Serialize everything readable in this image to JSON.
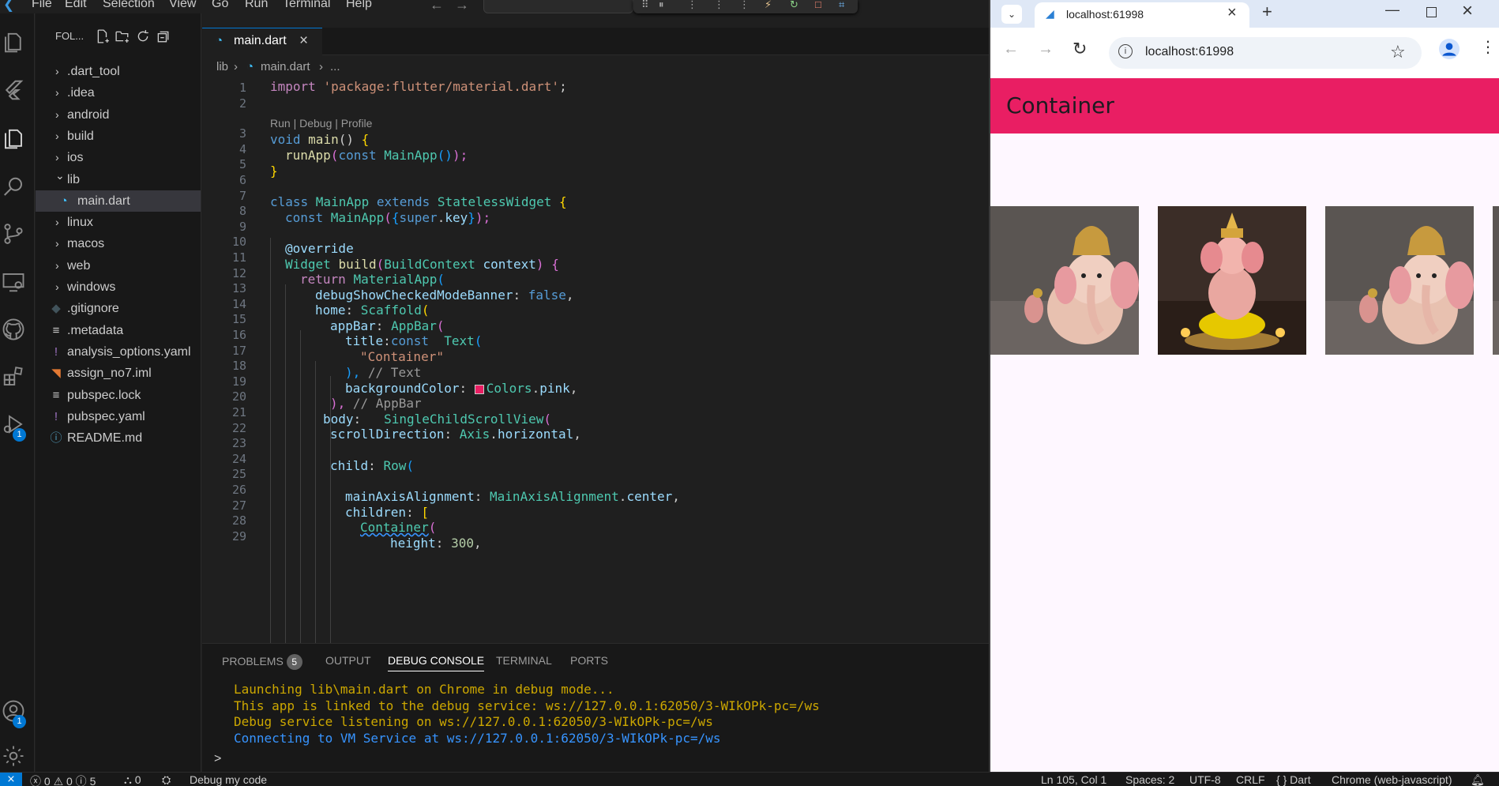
{
  "menubar": {
    "items": [
      "File",
      "Edit",
      "Selection",
      "View",
      "Go",
      "Run",
      "Terminal",
      "Help"
    ]
  },
  "activity_bar": {
    "items": [
      {
        "name": "explorer",
        "icon": "files-icon"
      },
      {
        "name": "flutter",
        "icon": "flutter-icon"
      },
      {
        "name": "explorer-active",
        "icon": "files-icon"
      },
      {
        "name": "search",
        "icon": "search-icon"
      },
      {
        "name": "source-control",
        "icon": "source-control-icon"
      },
      {
        "name": "remote-explorer",
        "icon": "remote-explorer-icon"
      },
      {
        "name": "github",
        "icon": "github-icon"
      },
      {
        "name": "extensions",
        "icon": "extensions-icon"
      },
      {
        "name": "run-debug",
        "icon": "run-debug-icon",
        "badge": "1"
      }
    ],
    "accounts_badge": "1"
  },
  "explorer": {
    "title": "FOL...",
    "items": [
      {
        "label": ".dart_tool",
        "type": "folder",
        "expanded": false
      },
      {
        "label": ".idea",
        "type": "folder",
        "expanded": false
      },
      {
        "label": "android",
        "type": "folder",
        "expanded": false
      },
      {
        "label": "build",
        "type": "folder",
        "expanded": false
      },
      {
        "label": "ios",
        "type": "folder",
        "expanded": false
      },
      {
        "label": "lib",
        "type": "folder",
        "expanded": true
      },
      {
        "label": "main.dart",
        "type": "dart",
        "selected": true
      },
      {
        "label": "linux",
        "type": "folder",
        "expanded": false
      },
      {
        "label": "macos",
        "type": "folder",
        "expanded": false
      },
      {
        "label": "web",
        "type": "folder",
        "expanded": false
      },
      {
        "label": "windows",
        "type": "folder",
        "expanded": false
      },
      {
        "label": ".gitignore",
        "type": "git"
      },
      {
        "label": ".metadata",
        "type": "text"
      },
      {
        "label": "analysis_options.yaml",
        "type": "yaml"
      },
      {
        "label": "assign_no7.iml",
        "type": "rss"
      },
      {
        "label": "pubspec.lock",
        "type": "text"
      },
      {
        "label": "pubspec.yaml",
        "type": "yaml"
      },
      {
        "label": "README.md",
        "type": "info"
      }
    ]
  },
  "editor": {
    "tab_label": "main.dart",
    "breadcrumb": [
      "lib",
      "main.dart",
      "..."
    ],
    "codelens": "Run | Debug | Profile",
    "line_numbers": [
      "1",
      "2",
      "3",
      "4",
      "5",
      "6",
      "7",
      "8",
      "9",
      "10",
      "11",
      "12",
      "13",
      "14",
      "15",
      "16",
      "17",
      "18",
      "19",
      "20",
      "21",
      "22",
      "23",
      "24",
      "25",
      "26",
      "27",
      "28",
      "29"
    ],
    "code": {
      "l1a": "import ",
      "l1b": "'package:flutter/material.dart'",
      "l1c": ";",
      "l3a": "void ",
      "l3b": "main",
      "l3c": "() ",
      "l3d": "{",
      "l4a": "runApp",
      "l4b": "(",
      "l4c": "const ",
      "l4d": "MainApp",
      "l4e": "()",
      "l4f": ");",
      "l5": "}",
      "l7a": "class ",
      "l7b": "MainApp ",
      "l7c": "extends ",
      "l7d": "StatelessWidget ",
      "l7e": "{",
      "l8a": "const ",
      "l8b": "MainApp",
      "l8c": "(",
      "l8d": "{",
      "l8e": "super",
      "l8f": ".",
      "l8g": "key",
      "l8h": "}",
      "l8i": ");",
      "l10": "@override",
      "l11a": "Widget ",
      "l11b": "build",
      "l11c": "(",
      "l11d": "BuildContext ",
      "l11e": "context",
      "l11f": ") ",
      "l11g": "{",
      "l12a": "return ",
      "l12b": "MaterialApp",
      "l12c": "(",
      "l13a": "debugShowCheckedModeBanner",
      "l13b": ": ",
      "l13c": "false",
      "l13d": ",",
      "l14a": "home",
      "l14b": ": ",
      "l14c": "Scaffold",
      "l14d": "(",
      "l15a": "appBar",
      "l15b": ": ",
      "l15c": "AppBar",
      "l15d": "(",
      "l16a": "title",
      "l16b": ":",
      "l16c": "const  ",
      "l16d": "Text",
      "l16e": "(",
      "l17": "\"Container\"",
      "l18a": "), ",
      "l18b": "// Text",
      "l19a": "backgroundColor",
      "l19b": ": ",
      "l19c": "Colors",
      "l19d": ".",
      "l19e": "pink",
      "l19f": ",",
      "l20a": "), ",
      "l20b": "// AppBar",
      "l21a": "body",
      "l21b": ":   ",
      "l21c": "SingleChildScrollView",
      "l21d": "(",
      "l22a": "scrollDirection",
      "l22b": ": ",
      "l22c": "Axis",
      "l22d": ".",
      "l22e": "horizontal",
      "l22f": ",",
      "l24a": "child",
      "l24b": ": ",
      "l24c": "Row",
      "l24d": "(",
      "l26a": "mainAxisAlignment",
      "l26b": ": ",
      "l26c": "MainAxisAlignment",
      "l26d": ".",
      "l26e": "center",
      "l26f": ",",
      "l27a": "children",
      "l27b": ": ",
      "l27c": "[",
      "l28a": "Container",
      "l28b": "(",
      "l29a": "height",
      "l29b": ": ",
      "l29c": "300",
      "l29d": ","
    },
    "swatch_color": "#e91e63"
  },
  "panel": {
    "tabs": [
      {
        "label": "PROBLEMS",
        "badge": "5"
      },
      {
        "label": "OUTPUT"
      },
      {
        "label": "DEBUG CONSOLE",
        "active": true
      },
      {
        "label": "TERMINAL"
      },
      {
        "label": "PORTS"
      }
    ],
    "console_lines": [
      {
        "text": "Launching lib\\main.dart on Chrome in debug mode...",
        "color": "#cca700"
      },
      {
        "text": "This app is linked to the debug service: ws://127.0.0.1:62050/3-WIkOPk-pc=/ws",
        "color": "#cca700"
      },
      {
        "text": "Debug service listening on ws://127.0.0.1:62050/3-WIkOPk-pc=/ws",
        "color": "#cca700"
      },
      {
        "text": "Connecting to VM Service at ws://127.0.0.1:62050/3-WIkOPk-pc=/ws",
        "color": "#3794ff"
      }
    ],
    "prompt": ">"
  },
  "statusbar": {
    "problems": "ⓧ 0 ⚠ 0 ⓘ 5",
    "ports": "⛬ 0",
    "debug": "Debug my code",
    "position": "Ln 105, Col 1",
    "spaces": "Spaces: 2",
    "encoding": "UTF-8",
    "eol": "CRLF",
    "language": "{ } Dart",
    "device": "Chrome (web-javascript)"
  },
  "browser": {
    "tab_title": "localhost:61998",
    "url": "localhost:61998",
    "app_title": "Container",
    "app_bar_color": "#e91e63",
    "body_color": "#fef7ff",
    "image_count": 4
  }
}
